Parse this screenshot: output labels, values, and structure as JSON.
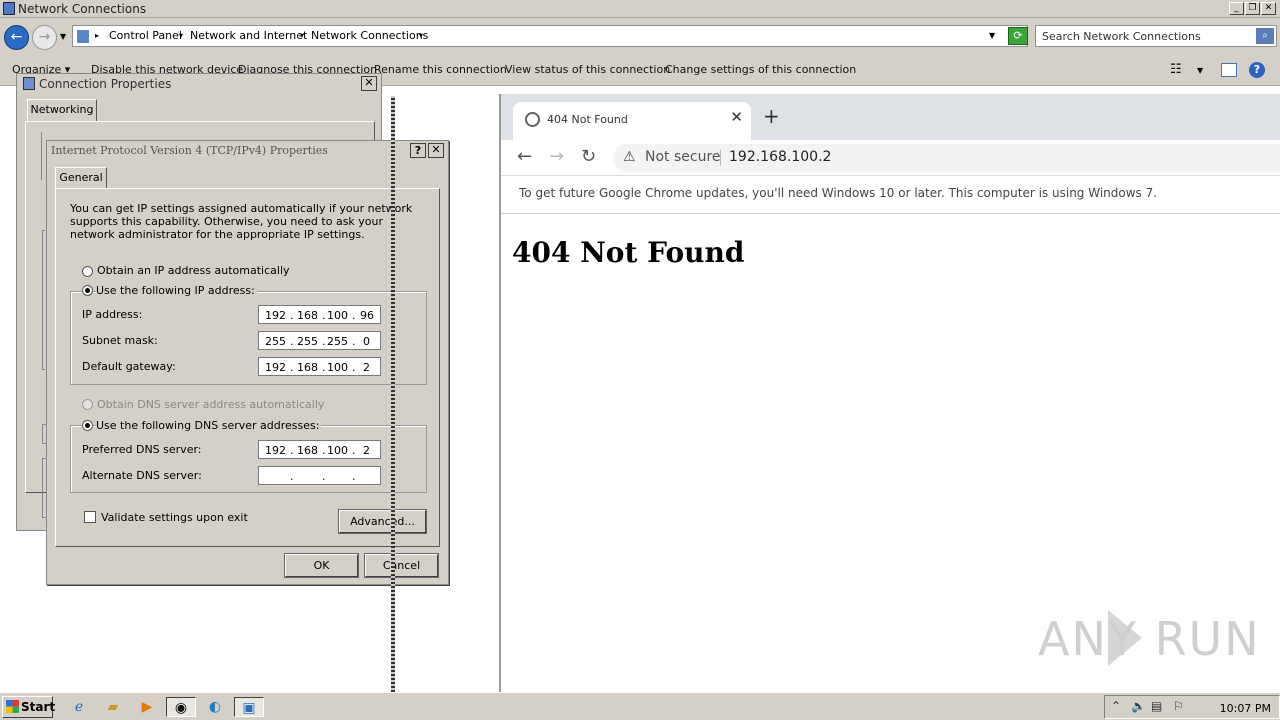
{
  "explorer": {
    "title": "Network Connections",
    "breadcrumb": [
      "Control Panel",
      "Network and Internet",
      "Network Connections"
    ],
    "search_placeholder": "Search Network Connections",
    "commands": [
      "Organize ▾",
      "Disable this network device",
      "Diagnose this connection",
      "Rename this connection",
      "View status of this connection",
      "Change settings of this connection"
    ]
  },
  "connprops": {
    "title": "Connection Properties",
    "tab": "Networking",
    "close": "✕"
  },
  "ipv4": {
    "title": "Internet Protocol Version 4 (TCP/IPv4) Properties",
    "help": "?",
    "close": "✕",
    "tab": "General",
    "description": "You can get IP settings assigned automatically if your network supports this capability. Otherwise, you need to ask your network administrator for the appropriate IP settings.",
    "obtain_ip_auto": "Obtain an IP address automatically",
    "use_following_ip": "Use the following IP address:",
    "ip_label": "IP address:",
    "ip_octets": [
      "192",
      "168",
      "100",
      "96"
    ],
    "subnet_label": "Subnet mask:",
    "subnet_octets": [
      "255",
      "255",
      "255",
      "0"
    ],
    "gateway_label": "Default gateway:",
    "gateway_octets": [
      "192",
      "168",
      "100",
      "2"
    ],
    "obtain_dns_auto": "Obtain DNS server address automatically",
    "use_following_dns": "Use the following DNS server addresses:",
    "preferred_dns_label": "Preferred DNS server:",
    "preferred_dns_octets": [
      "192",
      "168",
      "100",
      "2"
    ],
    "alternate_dns_label": "Alternate DNS server:",
    "validate_label": "Validate settings upon exit",
    "advanced": "Advanced...",
    "ok": "OK",
    "cancel": "Cancel"
  },
  "chrome": {
    "tab_title": "404 Not Found",
    "tab_close": "✕",
    "new_tab": "+",
    "not_secure": "Not secure",
    "url": "192.168.100.2",
    "infobar": "To get future Google Chrome updates, you'll need Windows 10 or later. This computer is using Windows 7.",
    "heading": "404 Not Found"
  },
  "watermark": "ANY RUN",
  "taskbar": {
    "start": "Start",
    "clock": "10:07 PM"
  }
}
